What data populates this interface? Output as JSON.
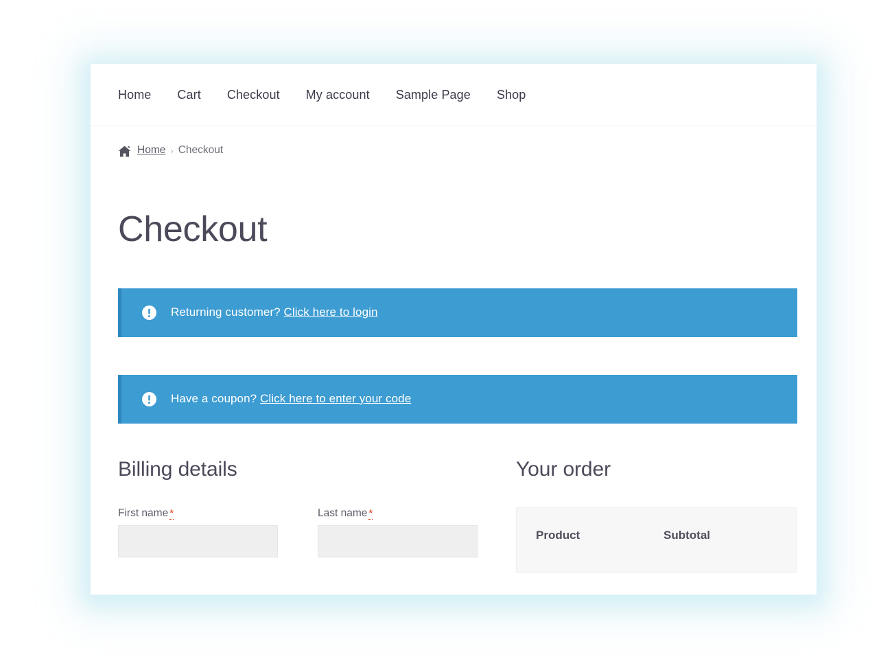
{
  "site_nav": {
    "items": [
      {
        "label": "Home"
      },
      {
        "label": "Cart"
      },
      {
        "label": "Checkout"
      },
      {
        "label": "My account"
      },
      {
        "label": "Sample Page"
      },
      {
        "label": "Shop"
      }
    ]
  },
  "breadcrumb": {
    "home_icon": "home-icon",
    "home_label": "Home",
    "separator": "›",
    "current": "Checkout"
  },
  "page": {
    "title": "Checkout"
  },
  "notices": {
    "login": {
      "icon": "exclamation-circle-icon",
      "prompt": "Returning customer?",
      "link": "Click here to login",
      "background": "#3d9cd2",
      "border": "#2e87bd"
    },
    "coupon": {
      "icon": "exclamation-circle-icon",
      "prompt": "Have a coupon?",
      "link": "Click here to enter your code",
      "background": "#3d9cd2",
      "border": "#2e87bd"
    }
  },
  "billing": {
    "heading": "Billing details",
    "fields": [
      {
        "label": "First name",
        "required_mark": "*",
        "value": "",
        "placeholder": ""
      },
      {
        "label": "Last name",
        "required_mark": "*",
        "value": "",
        "placeholder": ""
      }
    ]
  },
  "order": {
    "heading": "Your order",
    "columns": [
      {
        "label": "Product"
      },
      {
        "label": "Subtotal"
      }
    ],
    "rows": []
  },
  "colors": {
    "accent_blue": "#3d9cd2",
    "accent_blue_dark": "#2e87bd",
    "required_red": "#e2401c",
    "text_dark": "#4a4a5a",
    "input_bg": "#efefef",
    "panel_bg": "#f7f7f7"
  }
}
